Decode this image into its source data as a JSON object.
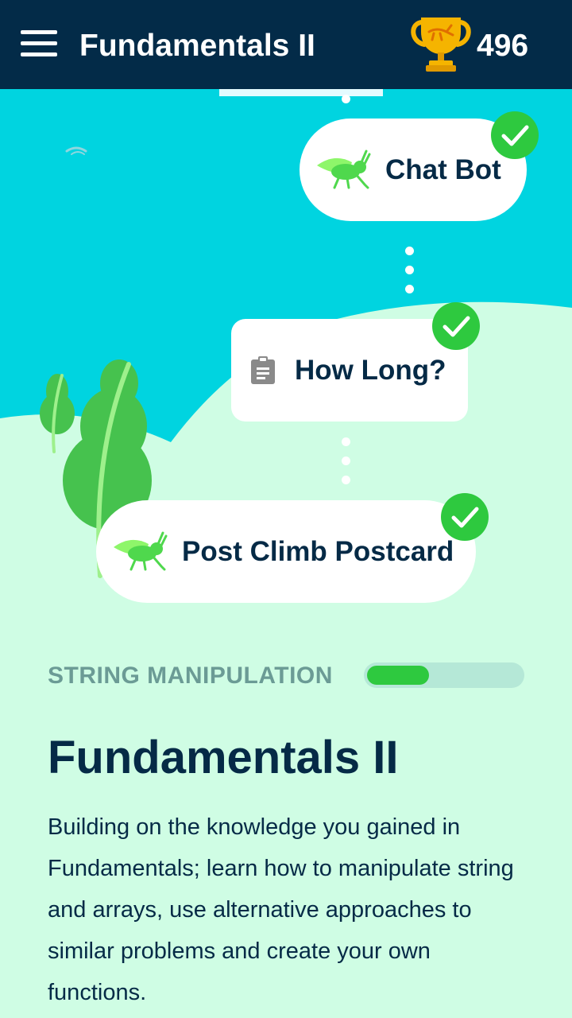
{
  "header": {
    "title": "Fundamentals II",
    "score": "496",
    "menu_icon": "hamburger-menu-icon",
    "trophy_icon": "trophy-icon"
  },
  "path": {
    "nodes": [
      {
        "label": "Chat Bot",
        "icon": "grasshopper-icon",
        "completed": true
      },
      {
        "label": "How Long?",
        "icon": "clipboard-icon",
        "completed": true
      },
      {
        "label": "Post Climb Postcard",
        "icon": "grasshopper-icon",
        "completed": true
      }
    ]
  },
  "section": {
    "label": "STRING MANIPULATION",
    "progress": 0.4
  },
  "course": {
    "title": "Fundamentals II",
    "description": "Building on the knowledge you gained in Fundamentals; learn how to manipulate string and arrays, use alternative approaches to similar problems and create your own functions."
  },
  "colors": {
    "header_bg": "#032b48",
    "sky": "#00d4e0",
    "hill": "#cffde4",
    "accent_green": "#2ec93f",
    "text_dark": "#052a46",
    "label_muted": "#6b9b95",
    "trophy_gold": "#f5b400"
  }
}
